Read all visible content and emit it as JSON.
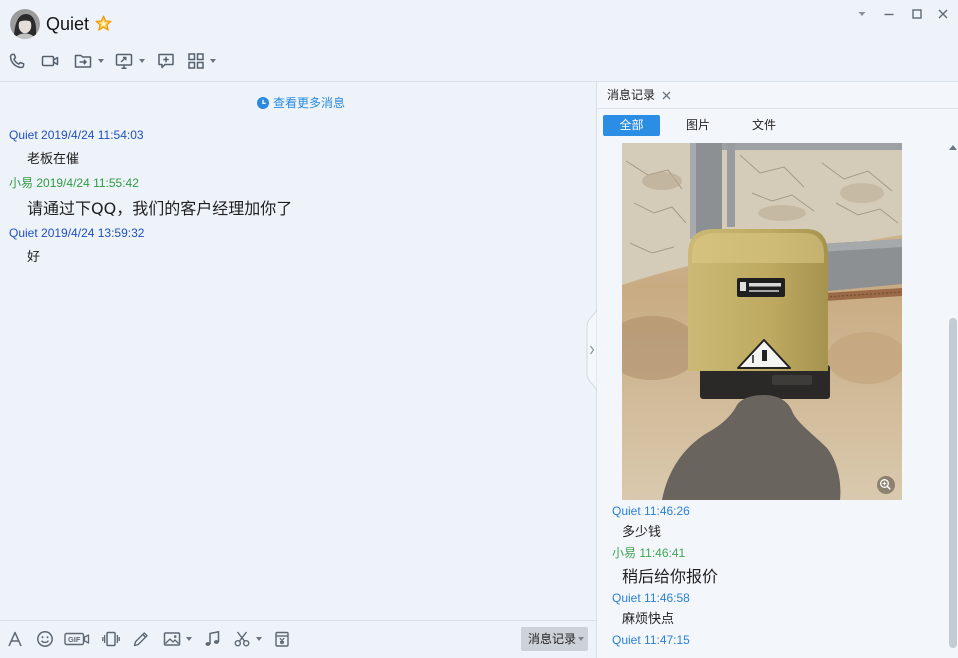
{
  "window": {
    "contact_name": "Quiet",
    "avatar_icon": "avatar",
    "badge_icon": "vip-star-icon",
    "controls": [
      "menu-dropdown-icon",
      "minimize-icon",
      "maximize-icon",
      "close-icon"
    ]
  },
  "toolbar": {
    "icons": [
      "phone-icon",
      "video-icon",
      "folder-transfer-icon",
      "screen-share-icon",
      "message-plus-icon",
      "apps-grid-icon"
    ]
  },
  "chat": {
    "more_messages": "查看更多消息",
    "messages": [
      {
        "sender": "Quiet",
        "time": "2019/4/24 11:54:03",
        "text": "老板在催"
      },
      {
        "sender": "小易",
        "time": "2019/4/24 11:55:42",
        "text": "请通过下QQ，我们的客户经理加你了"
      },
      {
        "sender": "Quiet",
        "time": "2019/4/24 13:59:32",
        "text": "好"
      }
    ]
  },
  "input_toolbar": {
    "icons": [
      "font-icon",
      "emoji-icon",
      "gif-icon",
      "shake-icon",
      "pen-icon",
      "image-icon",
      "music-icon",
      "scissors-icon",
      "red-packet-icon"
    ],
    "gif_label": "GIF",
    "history_button": "消息记录"
  },
  "history_panel": {
    "tab_label": "消息记录",
    "filters": [
      "全部",
      "图片",
      "文件"
    ],
    "selected_filter_index": 0,
    "image_message": {
      "zoom_icon": "zoom-in-icon"
    },
    "messages": [
      {
        "sender": "Quiet",
        "time": "11:46:26",
        "text": "多少钱"
      },
      {
        "sender": "小易",
        "time": "11:46:41",
        "text": "稍后给你报价"
      },
      {
        "sender": "Quiet",
        "time": "11:46:58",
        "text": "麻烦快点"
      },
      {
        "sender": "Quiet",
        "time": "11:47:15"
      }
    ]
  },
  "colors": {
    "background": "#eef3f9",
    "contact_sender": "#1f4fbf",
    "self_sender": "#2f9a42",
    "history_contact_sender": "#2c7fd4",
    "history_self_sender": "#3fa553",
    "link": "#2a8ae0",
    "accent": "#2b8de3"
  }
}
